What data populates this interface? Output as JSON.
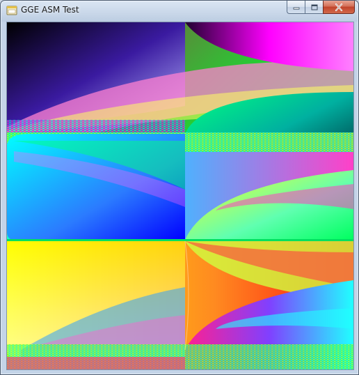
{
  "window": {
    "title": "GGE ASM Test",
    "icon": "app-window-icon",
    "caption": {
      "minimize_icon": "minimize-icon",
      "maximize_icon": "maximize-icon",
      "close_icon": "close-icon"
    }
  },
  "canvas": {
    "description_icon": "rendered-fractal-pattern",
    "colors": {
      "black": "#000000",
      "green": "#00ff00",
      "cyan": "#00ffff",
      "yellow": "#ffff00",
      "red": "#ff0000",
      "blue": "#0000ff",
      "magenta": "#ff00ff"
    }
  }
}
